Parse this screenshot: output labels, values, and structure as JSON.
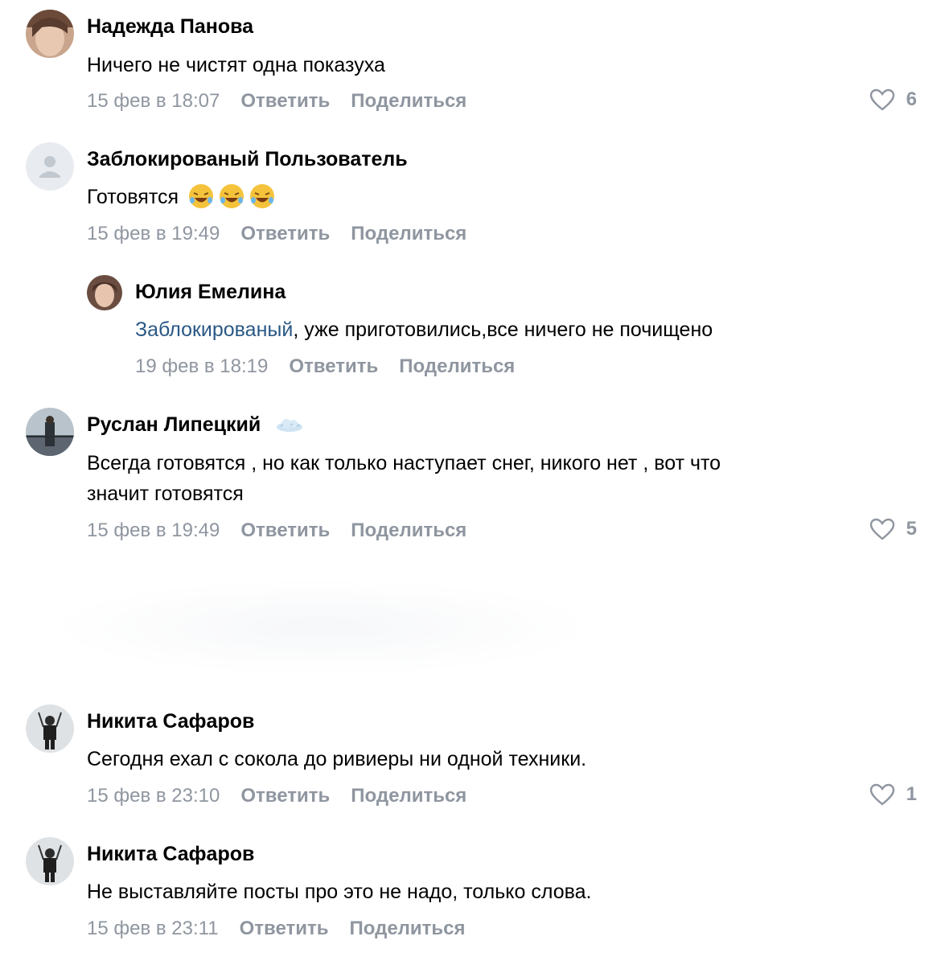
{
  "comments": [
    {
      "author": "Надежда Панова",
      "text": "Ничего не чистят одна показуха",
      "date": "15 фев в 18:07",
      "reply_label": "Ответить",
      "share_label": "Поделиться",
      "likes": "6"
    },
    {
      "author": "Заблокированый Пользователь",
      "text": "Готовятся",
      "date": "15 фев в 19:49",
      "reply_label": "Ответить",
      "share_label": "Поделиться",
      "emoji": "rolling-on-floor-laughing x3"
    },
    {
      "author": "Юлия Емелина",
      "mention": "Заблокированый",
      "text": ", уже приготовились,все ничего не почищено",
      "date": "19 фев в 18:19",
      "reply_label": "Ответить",
      "share_label": "Поделиться",
      "is_reply": true
    },
    {
      "author": "Руслан Липецкий",
      "text_line1": "Всегда готовятся , но как только наступает снег, никого нет , вот что",
      "text_line2": "значит готовятся",
      "date": "15 фев в 19:49",
      "reply_label": "Ответить",
      "share_label": "Поделиться",
      "likes": "5",
      "badge": "cloud-icon"
    },
    {
      "author": "Никита Сафаров",
      "text": "Сегодня ехал с сокола до ривиеры ни одной техники.",
      "date": "15 фев в 23:10",
      "reply_label": "Ответить",
      "share_label": "Поделиться",
      "likes": "1"
    },
    {
      "author": "Никита Сафаров",
      "text": "Не выставляйте посты про это не надо, только слова.",
      "date": "15 фев в 23:11",
      "reply_label": "Ответить",
      "share_label": "Поделиться"
    }
  ],
  "colors": {
    "meta_gray": "#8f96a0",
    "mention_blue": "#2a5885"
  }
}
